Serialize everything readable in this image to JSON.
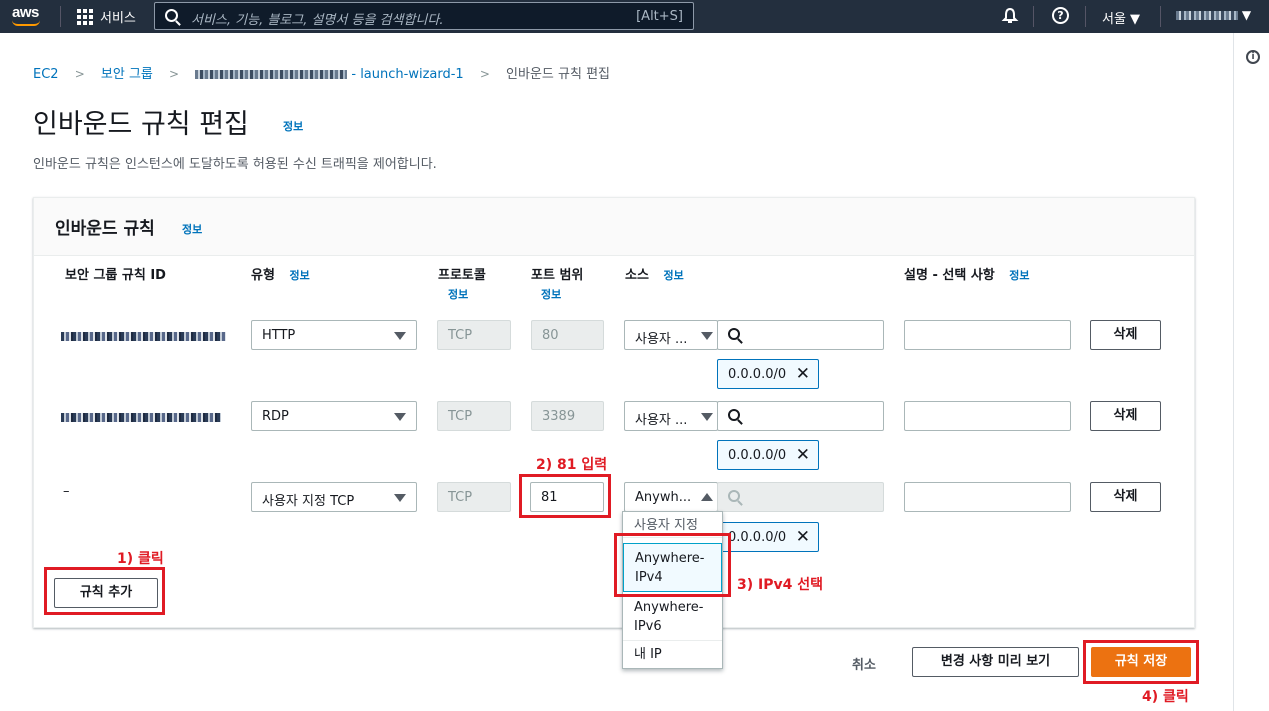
{
  "topbar": {
    "logo": "aws",
    "services_label": "서비스",
    "search_placeholder": "서비스, 기능, 블로그, 설명서 등을 검색합니다.",
    "search_shortcut": "[Alt+S]",
    "region": "서울 ▼",
    "account_suffix": "▼"
  },
  "breadcrumb": {
    "items": [
      "EC2",
      "보안 그룹",
      "- launch-wizard-1",
      "인바운드 규칙 편집"
    ]
  },
  "page": {
    "title": "인바운드 규칙 편집",
    "info": "정보",
    "description": "인바운드 규칙은 인스턴스에 도달하도록 허용된 수신 트래픽을 제어합니다."
  },
  "panel": {
    "title": "인바운드 규칙",
    "info": "정보",
    "columns": {
      "rule_id": "보안 그룹 규칙 ID",
      "type": "유형",
      "protocol": "프로토콜",
      "port_range": "포트 범위",
      "source": "소스",
      "description": "설명 - 선택 사항",
      "info": "정보"
    },
    "rows": [
      {
        "rule_id": "",
        "type": "HTTP",
        "protocol": "TCP",
        "port": "80",
        "source": "사용자 ...",
        "cidr": "0.0.0.0/0",
        "delete": "삭제"
      },
      {
        "rule_id": "",
        "type": "RDP",
        "protocol": "TCP",
        "port": "3389",
        "source": "사용자 ...",
        "cidr": "0.0.0.0/0",
        "delete": "삭제"
      },
      {
        "rule_id": "–",
        "type": "사용자 지정 TCP",
        "protocol": "TCP",
        "port": "81",
        "source": "Anywh...",
        "cidr": "0.0.0.0/0",
        "delete": "삭제"
      }
    ],
    "add_rule": "규칙 추가"
  },
  "dropdown": {
    "options": [
      "사용자 지정",
      "Anywhere-IPv4",
      "Anywhere-IPv6",
      "내 IP"
    ]
  },
  "footer": {
    "cancel": "취소",
    "preview": "변경 사항 미리 보기",
    "save": "규칙 저장"
  },
  "annotations": {
    "step1": "1) 클릭",
    "step2": "2) 81 입력",
    "step3": "3) IPv4 선택",
    "step4": "4) 클릭"
  },
  "colors": {
    "topbar": "#232f3e",
    "link": "#0073bb",
    "primary": "#ec7211",
    "annotation": "#e01b24"
  }
}
